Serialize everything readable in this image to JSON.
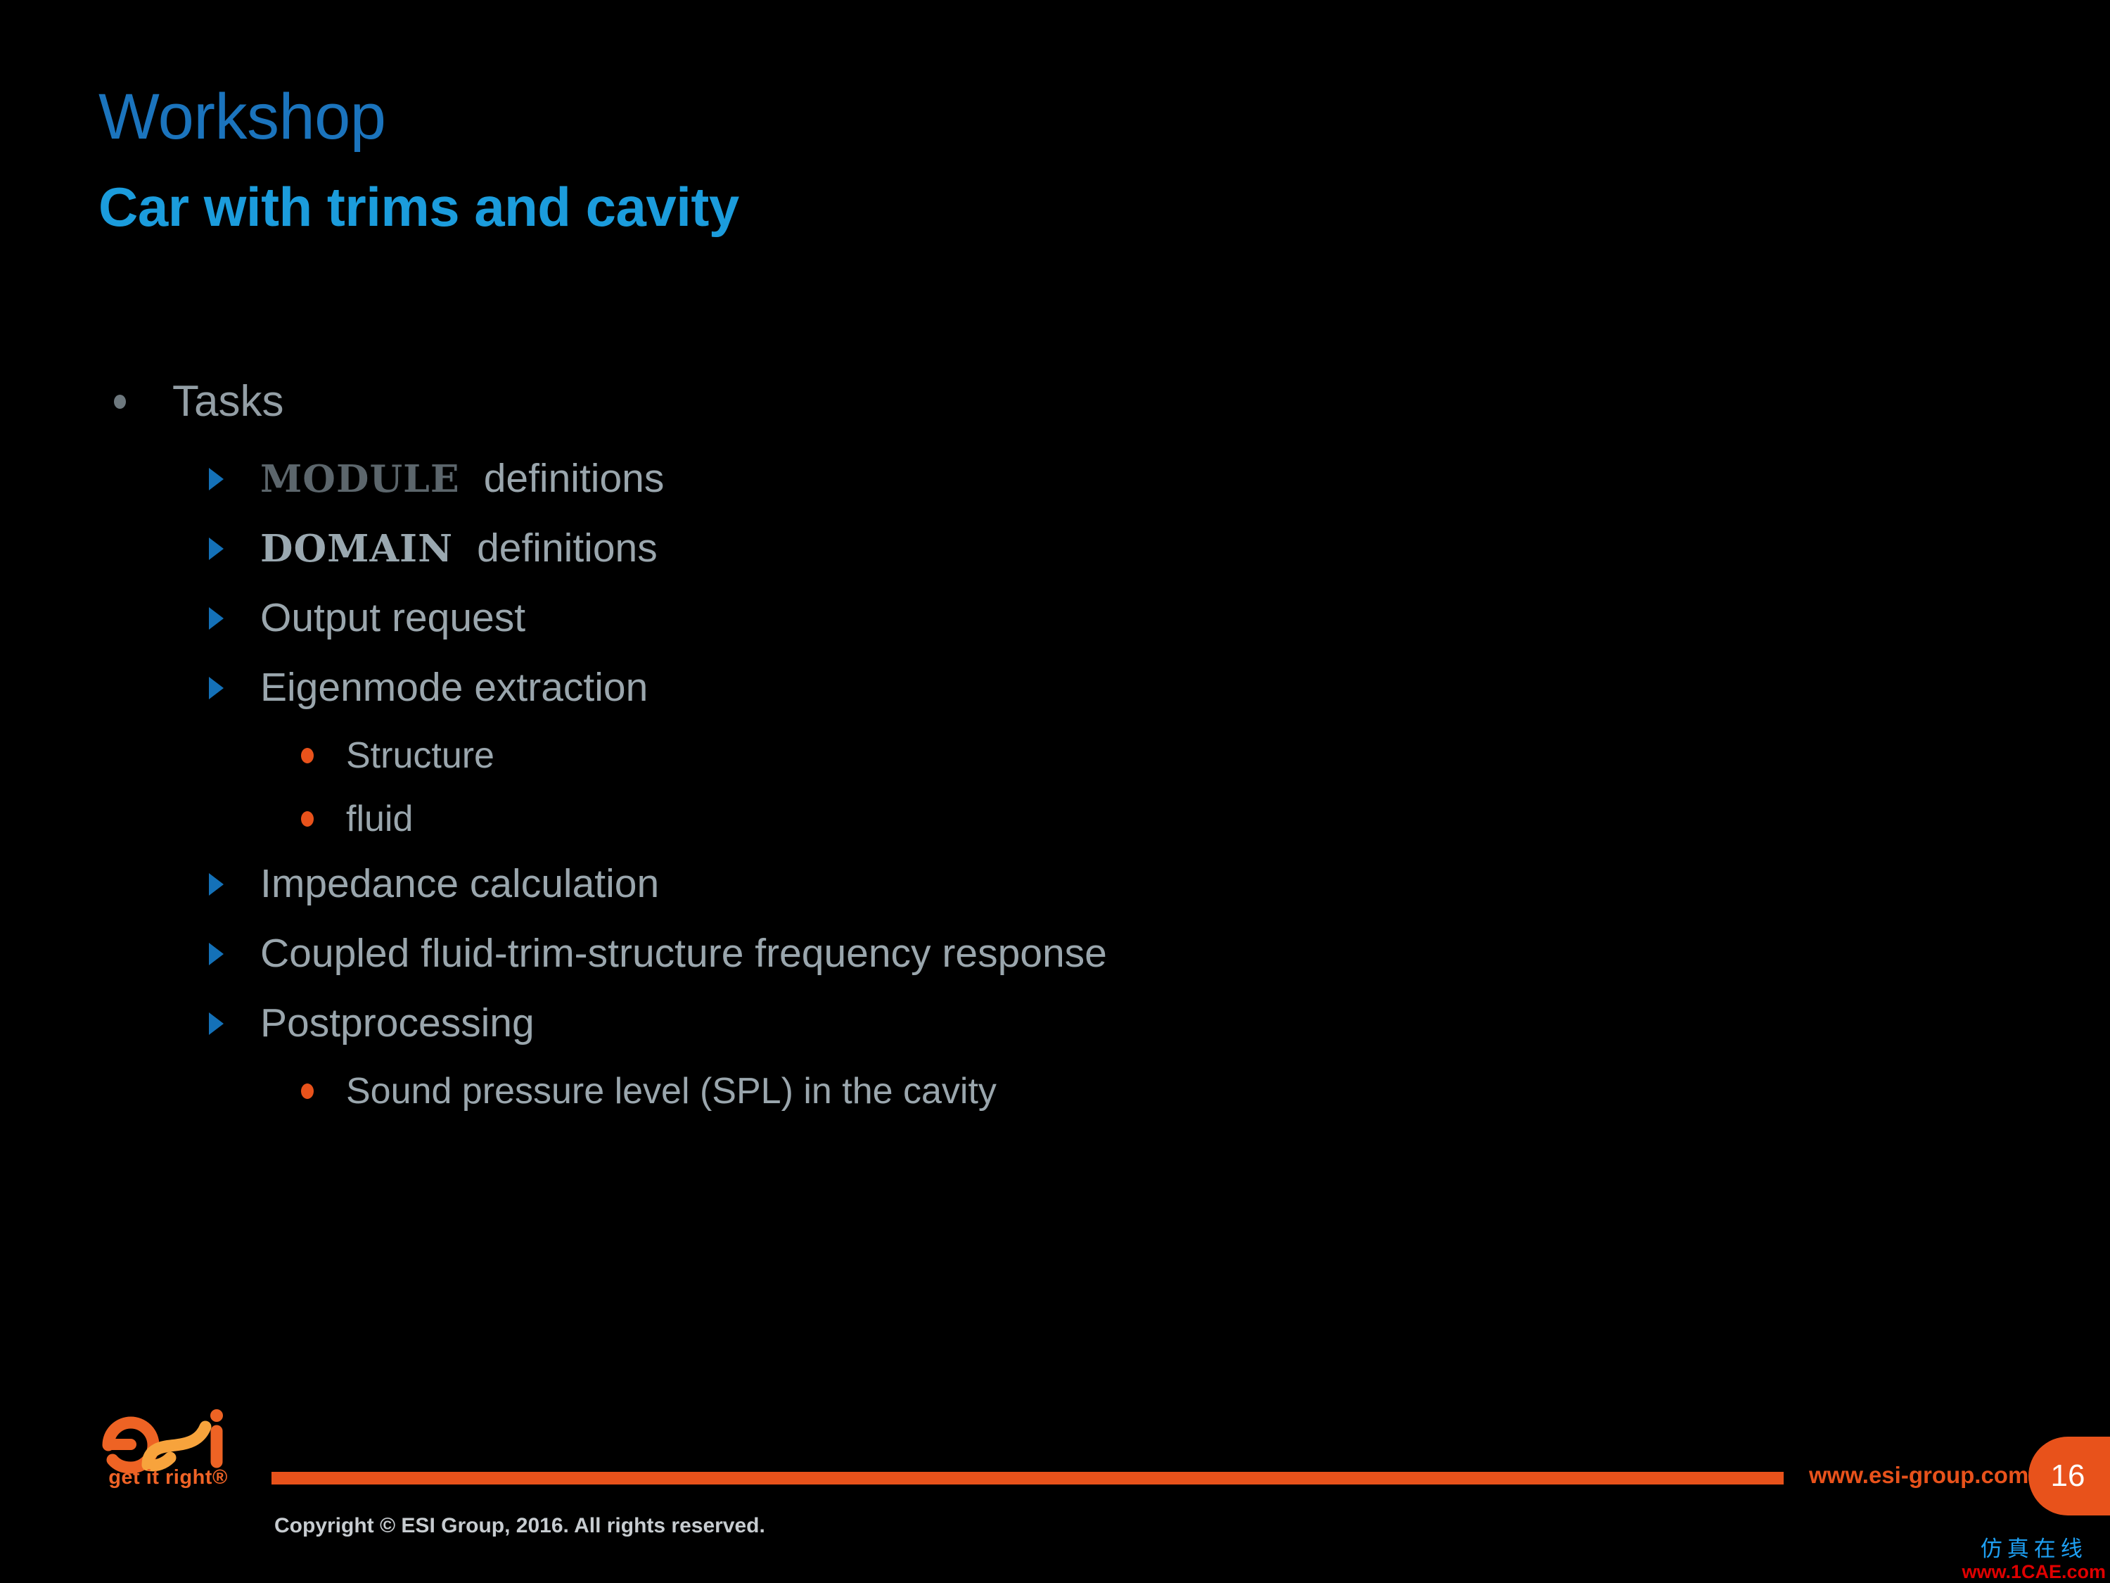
{
  "slide": {
    "title": "Workshop",
    "subtitle": "Car with trims and cavity",
    "title_color": "#1b74bd",
    "subtitle_color": "#1b9cdc",
    "background_color": "#000000"
  },
  "content": {
    "level1": {
      "label": "Tasks"
    },
    "items": [
      {
        "keyword": "MODULE",
        "keyword_style": "dark",
        "text": "definitions"
      },
      {
        "keyword": "DOMAIN",
        "keyword_style": "light",
        "text": "definitions"
      },
      {
        "text": "Output request"
      },
      {
        "text": "Eigenmode extraction"
      },
      {
        "text": "Impedance calculation"
      },
      {
        "text": "Coupled fluid-trim-structure frequency response"
      },
      {
        "text": "Postprocessing"
      }
    ],
    "sub_eigenmode": [
      {
        "text": "Structure"
      },
      {
        "text": "fluid"
      }
    ],
    "sub_postprocessing": [
      {
        "text": "Sound pressure level (SPL) in the cavity"
      }
    ]
  },
  "footer": {
    "logo_text": "esi",
    "logo_tagline": "get it right®",
    "site_url": "www.esi-group.com",
    "page_number": "16",
    "copyright": "Copyright © ESI Group, 2016. All rights reserved.",
    "rule_color": "#e8521b",
    "badge_color": "#e8521b",
    "logo_orange_dark": "#ee6324",
    "logo_orange_light": "#f7a33c"
  },
  "watermark": {
    "cn_text": "仿真在线",
    "url_text": "www.1CAE.com",
    "cn_color": "#1e9ff2",
    "url_color": "#e00000"
  }
}
